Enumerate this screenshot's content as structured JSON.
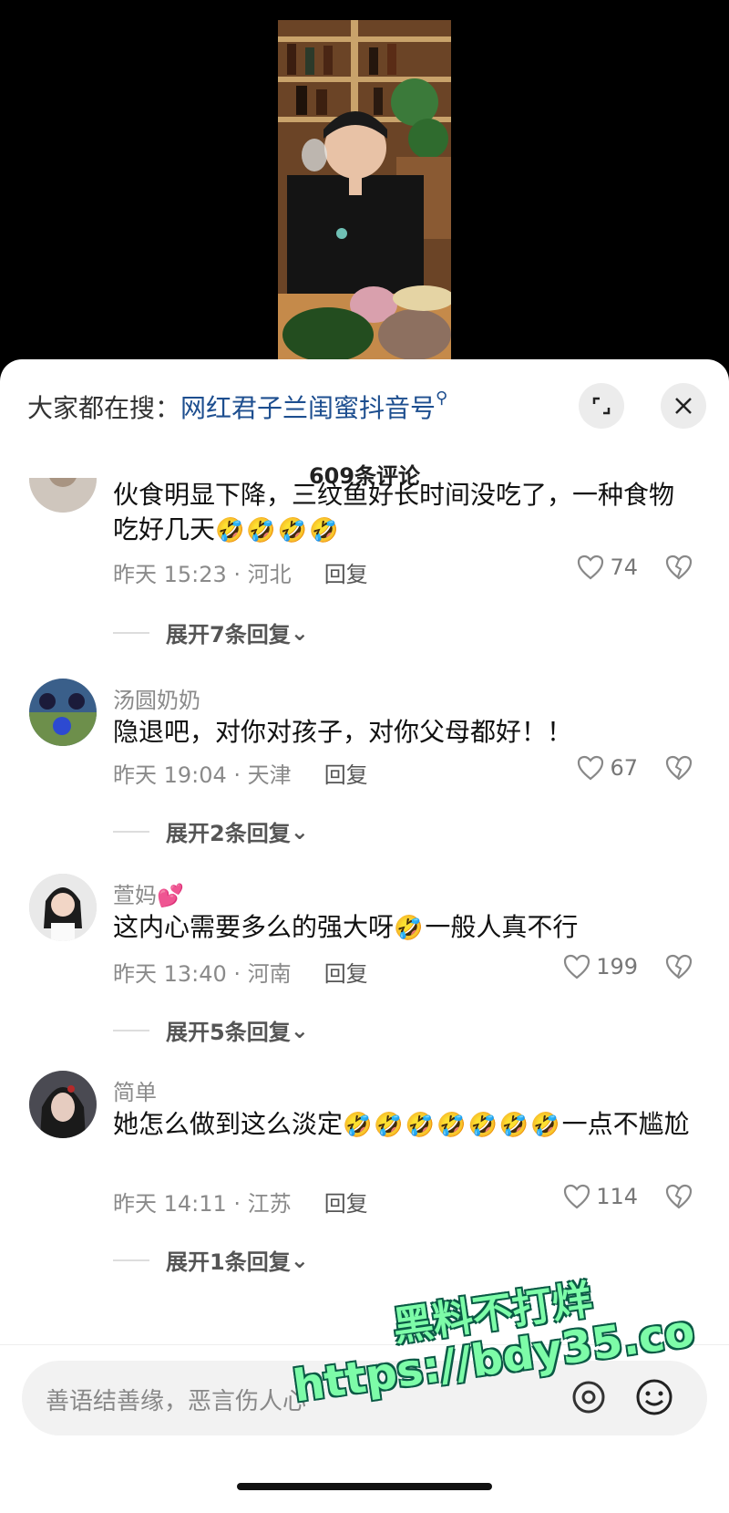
{
  "search": {
    "prefix": "大家都在搜：",
    "term": "网红君子兰闺蜜抖音号",
    "icon": "search-icon"
  },
  "comment_count": "609条评论",
  "comments": [
    {
      "username": "",
      "text": "伙食明显下降，三纹鱼好长时间没吃了，一种食物吃好几天",
      "emoji": "🤣🤣🤣🤣",
      "time": "昨天 15:23 · 河北",
      "reply": "回复",
      "likes": "74",
      "expand": "展开7条回复"
    },
    {
      "username": "汤圆奶奶",
      "text": "隐退吧，对你对孩子，对你父母都好！！",
      "emoji": "",
      "time": "昨天 19:04 · 天津",
      "reply": "回复",
      "likes": "67",
      "expand": "展开2条回复"
    },
    {
      "username": "萱妈",
      "username_emoji": "💕",
      "text": "这内心需要多么的强大呀",
      "emoji": "🤣",
      "text_after": "一般人真不行",
      "time": "昨天 13:40 · 河南",
      "reply": "回复",
      "likes": "199",
      "expand": "展开5条回复"
    },
    {
      "username": "简单",
      "text": "她怎么做到这么淡定",
      "emoji": "🤣🤣🤣🤣🤣🤣🤣",
      "text_after": "一点不尴尬",
      "time": "昨天 14:11 · 江苏",
      "reply": "回复",
      "likes": "114",
      "expand": "展开1条回复"
    }
  ],
  "input_placeholder": "善语结善缘，恶言伤人心",
  "watermark": {
    "line1": "黑料不打烊",
    "line2": "https://bdy35.co"
  },
  "colors": {
    "link": "#1d4e8f",
    "watermark": "#7dfca8"
  }
}
